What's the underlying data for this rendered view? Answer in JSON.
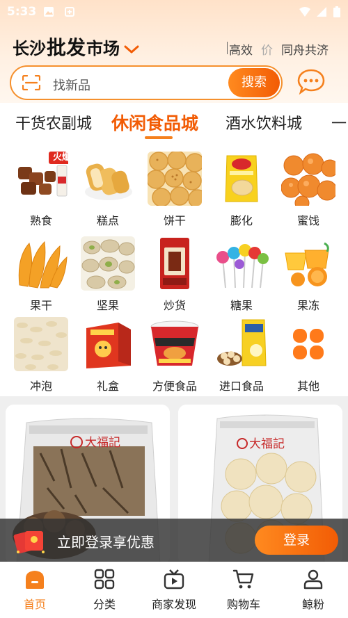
{
  "status_bar": {
    "time": "5:33"
  },
  "header": {
    "city_prefix": "长沙",
    "city_highlight": "批发",
    "city_suffix": "市场",
    "slogan": [
      "高效",
      "价",
      "同舟共济"
    ]
  },
  "search": {
    "placeholder": "找新品",
    "button": "搜索"
  },
  "tabs": [
    {
      "label": "干货农副城",
      "active": false
    },
    {
      "label": "休闲食品城",
      "active": true
    },
    {
      "label": "酒水饮料城",
      "active": false
    },
    {
      "label": "一",
      "active": false
    }
  ],
  "categories": [
    {
      "label": "熟食",
      "badge": "火爆",
      "icon": "cooked-food-icon"
    },
    {
      "label": "糕点",
      "icon": "pastry-icon"
    },
    {
      "label": "饼干",
      "icon": "biscuit-icon"
    },
    {
      "label": "膨化",
      "icon": "puffed-snack-icon"
    },
    {
      "label": "蜜饯",
      "icon": "candied-fruit-icon"
    },
    {
      "label": "果干",
      "icon": "dried-fruit-icon"
    },
    {
      "label": "坚果",
      "icon": "nut-icon"
    },
    {
      "label": "炒货",
      "icon": "roasted-seed-icon"
    },
    {
      "label": "糖果",
      "icon": "candy-icon"
    },
    {
      "label": "果冻",
      "icon": "jelly-icon"
    },
    {
      "label": "冲泡",
      "icon": "instant-drink-icon"
    },
    {
      "label": "礼盒",
      "icon": "gift-box-icon"
    },
    {
      "label": "方便食品",
      "icon": "instant-noodle-icon"
    },
    {
      "label": "进口食品",
      "icon": "imported-food-icon"
    },
    {
      "label": "其他",
      "icon": "other-icon"
    }
  ],
  "products": [
    {
      "brand": "大福記"
    },
    {
      "brand": "大福記"
    }
  ],
  "login_banner": {
    "text": "立即登录享优惠",
    "button": "登录"
  },
  "bottom_nav": [
    {
      "label": "首页",
      "icon": "home-icon",
      "active": true
    },
    {
      "label": "分类",
      "icon": "category-icon",
      "active": false
    },
    {
      "label": "商家发现",
      "icon": "merchant-discover-icon",
      "active": false
    },
    {
      "label": "购物车",
      "icon": "cart-icon",
      "active": false
    },
    {
      "label": "鲸粉",
      "icon": "profile-icon",
      "active": false
    }
  ],
  "colors": {
    "accent": "#f5801d",
    "accent_dark": "#f25c05"
  }
}
